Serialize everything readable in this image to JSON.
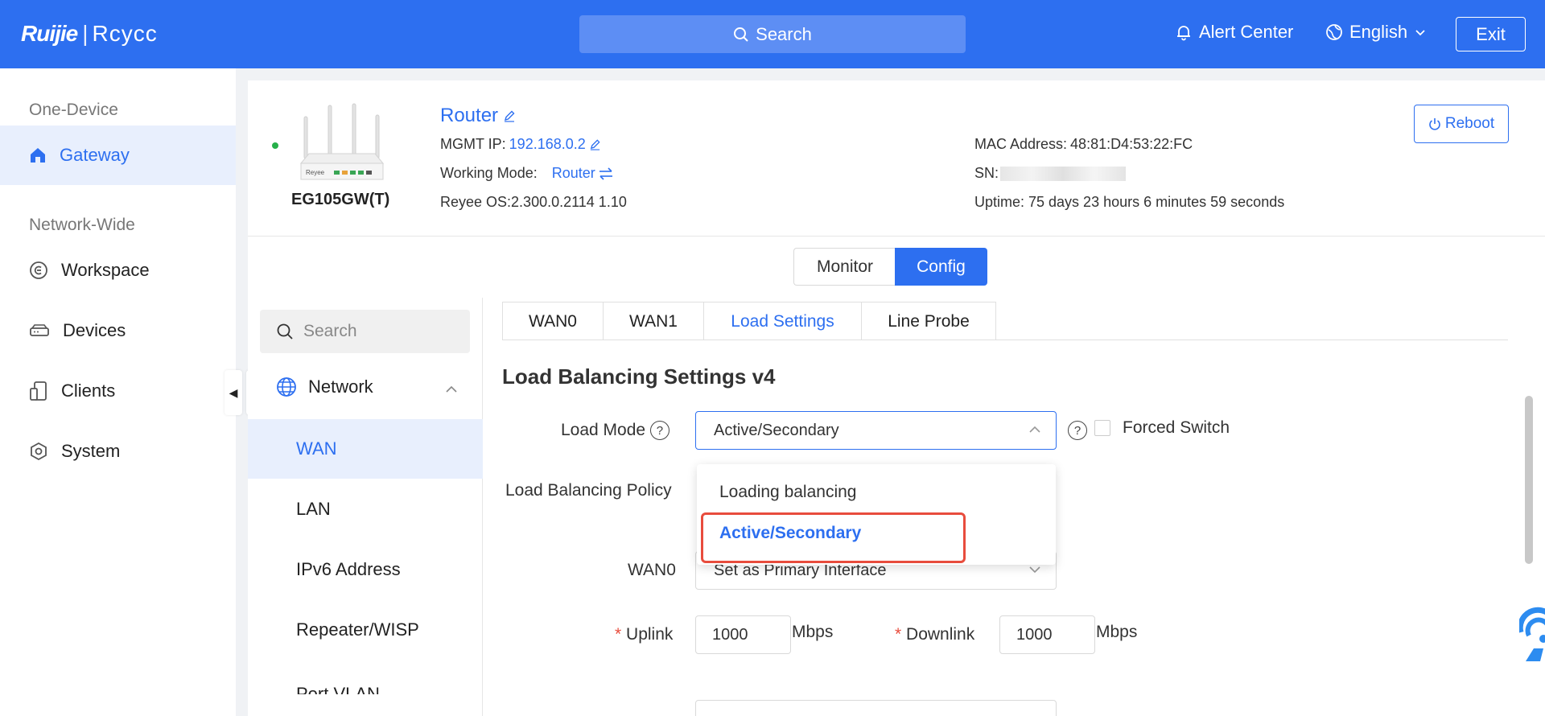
{
  "header": {
    "brand_ruijie": "Ruijie",
    "brand_sep": "|",
    "brand_reyee": "Rcycc",
    "search_label": "Search",
    "alert_center": "Alert Center",
    "language": "English",
    "exit": "Exit"
  },
  "sidebar": {
    "section_one_device": "One-Device",
    "gateway": "Gateway",
    "section_network_wide": "Network-Wide",
    "workspace": "Workspace",
    "devices": "Devices",
    "clients": "Clients",
    "system": "System"
  },
  "device": {
    "name": "Router",
    "model": "EG105GW(T)",
    "mgmt_ip_label": "MGMT IP:",
    "mgmt_ip": "192.168.0.2",
    "working_mode_label": "Working Mode:",
    "working_mode": "Router",
    "os": "Reyee OS:2.300.0.2114 1.10",
    "mac_label": "MAC Address:",
    "mac": "48:81:D4:53:22:FC",
    "sn_label": "SN:",
    "uptime": "Uptime: 75 days 23 hours 6 minutes 59 seconds",
    "reboot": "Reboot",
    "router_badge": "Reyee"
  },
  "view_toggle": {
    "monitor": "Monitor",
    "config": "Config"
  },
  "inner_nav": {
    "search_placeholder": "Search",
    "group": "Network",
    "items": [
      "WAN",
      "LAN",
      "IPv6 Address",
      "Repeater/WISP",
      "Port VLAN"
    ]
  },
  "tabs": [
    "WAN0",
    "WAN1",
    "Load Settings",
    "Line Probe"
  ],
  "form": {
    "title": "Load Balancing Settings v4",
    "load_mode_label": "Load Mode",
    "load_mode_value": "Active/Secondary",
    "forced_switch": "Forced Switch",
    "policy_label": "Load Balancing Policy",
    "wan0_label": "WAN0",
    "wan0_value": "Set as Primary Interface",
    "uplink_label": "Uplink",
    "uplink_value": "1000",
    "downlink_label": "Downlink",
    "downlink_value": "1000",
    "unit": "Mbps",
    "required_mark": "*",
    "help_mark": "?"
  },
  "dropdown": {
    "options": [
      "Loading balancing",
      "Active/Secondary"
    ],
    "selected_index": 1
  },
  "colors": {
    "primary": "#2d6ff0",
    "highlight": "#e84c3d",
    "status_online": "#26b04a"
  }
}
